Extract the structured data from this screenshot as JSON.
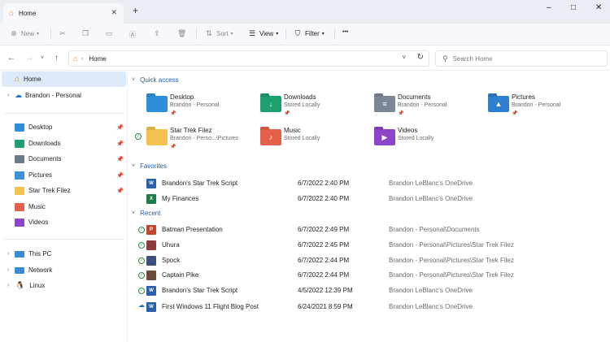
{
  "tab": {
    "title": "Home",
    "icon": "home-icon"
  },
  "window_controls": {
    "minimize": "–",
    "maximize": "□",
    "close": "✕"
  },
  "toolbar": {
    "new_label": "New",
    "sort_label": "Sort",
    "view_label": "View",
    "filter_label": "Filter",
    "more_label": "•••"
  },
  "address": {
    "path": "Home"
  },
  "search": {
    "placeholder": "Search Home"
  },
  "sidebar": {
    "home": "Home",
    "onedrive": "Brandon - Personal",
    "pinned": [
      {
        "label": "Desktop",
        "color": "#2d8fd8"
      },
      {
        "label": "Downloads",
        "color": "#1e9f6e"
      },
      {
        "label": "Documents",
        "color": "#6c7a8c"
      },
      {
        "label": "Pictures",
        "color": "#3f8fd8"
      },
      {
        "label": "Star Trek Filez",
        "color": "#f2c14e"
      },
      {
        "label": "Music",
        "color": "#e5604a"
      },
      {
        "label": "Videos",
        "color": "#8e44c8"
      }
    ],
    "this_pc": "This PC",
    "network": "Network",
    "linux": "Linux"
  },
  "main": {
    "quick_access": {
      "header": "Quick access",
      "items": [
        {
          "name": "Desktop",
          "sub": "Brandon - Personal",
          "color": "#2d8fd8",
          "glyph": "",
          "pinned": true
        },
        {
          "name": "Downloads",
          "sub": "Stored Locally",
          "color": "#1e9f6e",
          "glyph": "↓",
          "pinned": true
        },
        {
          "name": "Documents",
          "sub": "Brandon - Personal",
          "color": "#7a8797",
          "glyph": "≡",
          "pinned": true
        },
        {
          "name": "Pictures",
          "sub": "Brandon - Personal",
          "color": "#2f7fd0",
          "glyph": "▲",
          "pinned": true
        },
        {
          "name": "Star Trek Filez",
          "sub": "Brandon - Perso...\\Pictures",
          "color": "#f2c14e",
          "glyph": "",
          "pinned": true
        },
        {
          "name": "Music",
          "sub": "Stored Locally",
          "color": "#e5604a",
          "glyph": "♪",
          "pinned": false
        },
        {
          "name": "Videos",
          "sub": "Stored Locally",
          "color": "#8e44c8",
          "glyph": "▶",
          "pinned": false
        }
      ]
    },
    "favorites": {
      "header": "Favorites",
      "files": [
        {
          "name": "Brandon's Star Trek Script",
          "date": "6/7/2022 2:40 PM",
          "location": "Brandon LeBlanc's OneDrive",
          "type": "W",
          "color": "#2b5faa"
        },
        {
          "name": "My Finances",
          "date": "6/7/2022 2:40 PM",
          "location": "Brandon LeBlanc's OneDrive",
          "type": "X",
          "color": "#1e7a46"
        }
      ]
    },
    "recent": {
      "header": "Recent",
      "files": [
        {
          "name": "Batman Presentation",
          "date": "6/7/2022 2:49 PM",
          "location": "Brandon - Personal\\Documents",
          "type": "P",
          "color": "#c4452c",
          "status": "synced"
        },
        {
          "name": "Uhura",
          "date": "6/7/2022 2:45 PM",
          "location": "Brandon - Personal\\Pictures\\Star Trek Filez",
          "type": "",
          "color": "#8a3b3b",
          "status": "synced"
        },
        {
          "name": "Spock",
          "date": "6/7/2022 2:44 PM",
          "location": "Brandon - Personal\\Pictures\\Star Trek Filez",
          "type": "",
          "color": "#3b4f7a",
          "status": "synced"
        },
        {
          "name": "Captain Pike",
          "date": "6/7/2022 2:44 PM",
          "location": "Brandon - Personal\\Pictures\\Star Trek Filez",
          "type": "",
          "color": "#6a4a3a",
          "status": "synced"
        },
        {
          "name": "Brandon's Star Trek Script",
          "date": "4/5/2022 12:39 PM",
          "location": "Brandon LeBlanc's OneDrive",
          "type": "W",
          "color": "#2b5faa",
          "status": "synced"
        },
        {
          "name": "First Windows 11 Flight Blog Post",
          "date": "6/24/2021 8:59 PM",
          "location": "Brandon LeBlanc's OneDrive",
          "type": "W",
          "color": "#2b5faa",
          "status": "cloud"
        }
      ]
    }
  }
}
